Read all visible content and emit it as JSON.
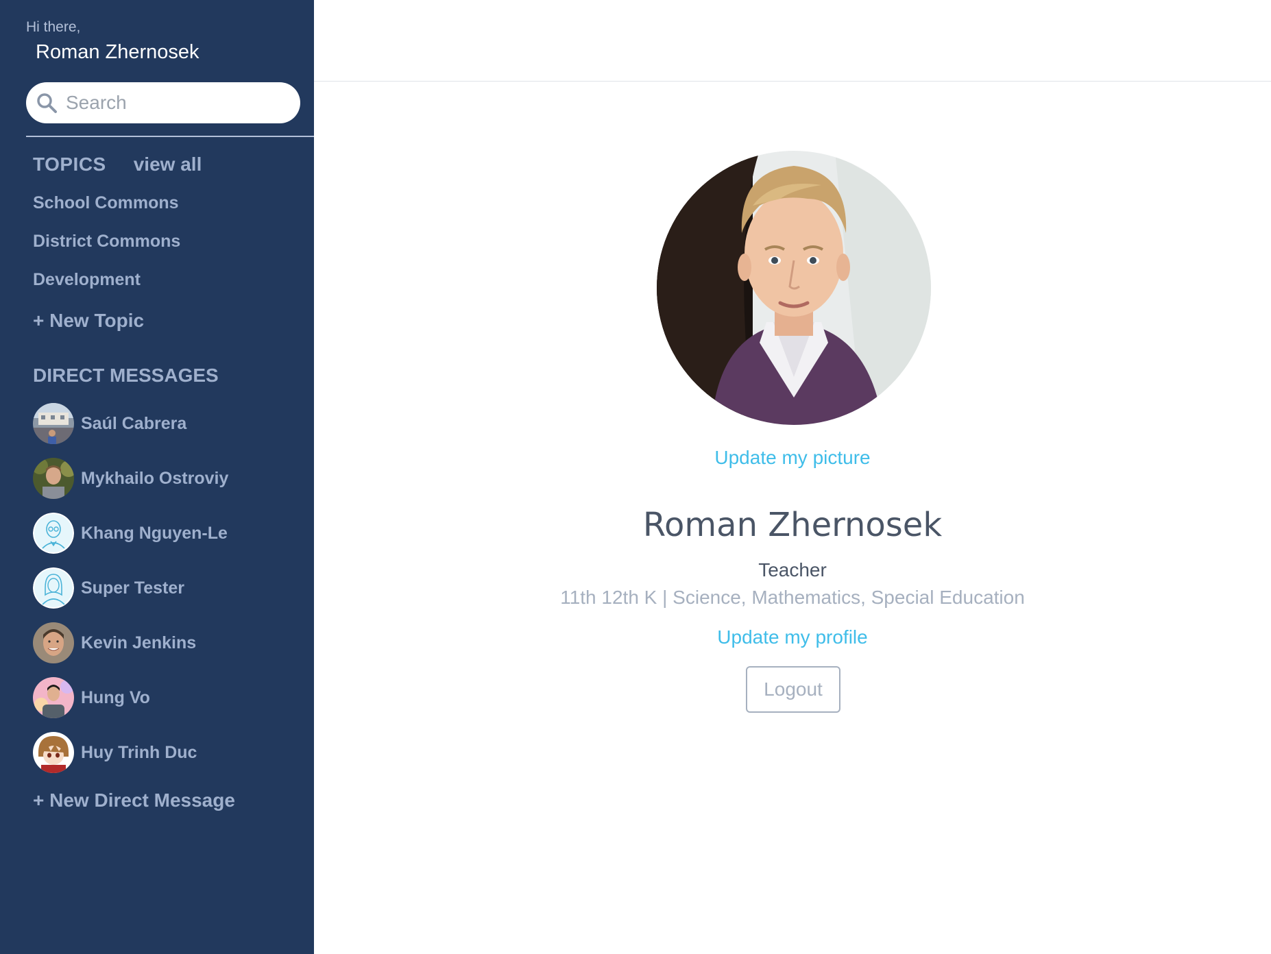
{
  "sidebar": {
    "greeting": "Hi there,",
    "user_name": "Roman Zhernosek",
    "search": {
      "placeholder": "Search",
      "icon": "search-icon"
    },
    "topics": {
      "title": "TOPICS",
      "view_all": "view all",
      "items": [
        "School Commons",
        "District Commons",
        "Development"
      ],
      "new_label": "+ New Topic"
    },
    "direct_messages": {
      "title": "DIRECT MESSAGES",
      "items": [
        {
          "name": "Saúl Cabrera"
        },
        {
          "name": "Mykhailo Ostroviy"
        },
        {
          "name": "Khang Nguyen-Le"
        },
        {
          "name": "Super Tester"
        },
        {
          "name": "Kevin Jenkins"
        },
        {
          "name": "Hung Vo"
        },
        {
          "name": "Huy Trinh Duc"
        }
      ],
      "new_label": "+ New Direct Message"
    }
  },
  "profile": {
    "update_picture_label": "Update my picture",
    "name": "Roman Zhernosek",
    "role": "Teacher",
    "details": "11th 12th K | Science, Mathematics, Special Education",
    "update_profile_label": "Update my profile",
    "logout_label": "Logout"
  },
  "colors": {
    "sidebar_bg": "#22395d",
    "sidebar_text": "#9fb0cd",
    "link": "#3fbde9",
    "heading": "#4a5566",
    "muted": "#a6b0bf"
  }
}
